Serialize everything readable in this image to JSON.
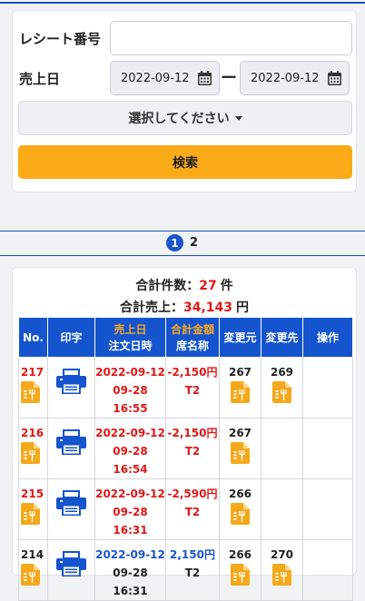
{
  "search": {
    "receipt_label": "レシート番号",
    "receipt_value": "",
    "date_label": "売上日",
    "date_from": "2022-09-12",
    "date_to": "2022-09-12",
    "date_separator": "ー",
    "select_placeholder": "選択してください",
    "search_button": "検索"
  },
  "pagination": {
    "current": "1",
    "next": "2"
  },
  "summary": {
    "count_label": "合計件数：",
    "count_value": "27",
    "count_unit": "件",
    "sales_label": "合計売上：",
    "sales_value": "34,143",
    "sales_unit": "円"
  },
  "table": {
    "headers": {
      "no": "No.",
      "print": "印字",
      "sales_date": "売上日",
      "order_datetime": "注文日時",
      "total_amount": "合計金額",
      "seat_name": "席名称",
      "change_from": "変更元",
      "change_to": "変更先",
      "action": "操作"
    },
    "rows": [
      {
        "no": "217",
        "sales_date": "2022-09-12",
        "order_datetime": "09-28 16:55",
        "amount": "-2,150円",
        "seat": "T2",
        "change_from": "267",
        "change_to": "269",
        "negative": true
      },
      {
        "no": "216",
        "sales_date": "2022-09-12",
        "order_datetime": "09-28 16:54",
        "amount": "-2,150円",
        "seat": "T2",
        "change_from": "267",
        "change_to": "",
        "negative": true
      },
      {
        "no": "215",
        "sales_date": "2022-09-12",
        "order_datetime": "09-28 16:31",
        "amount": "-2,590円",
        "seat": "T2",
        "change_from": "266",
        "change_to": "",
        "negative": true
      },
      {
        "no": "214",
        "sales_date": "2022-09-12",
        "order_datetime": "09-28 16:31",
        "amount": "2,150円",
        "seat": "T2",
        "change_from": "266",
        "change_to": "270",
        "negative": false
      }
    ]
  },
  "colors": {
    "primary": "#1554cf",
    "accent": "#fbab18",
    "negative": "#e01818",
    "positive": "#1a54c9"
  },
  "icons": {
    "calendar": "calendar-icon",
    "printer": "printer-icon",
    "receipt": "receipt-icon"
  }
}
